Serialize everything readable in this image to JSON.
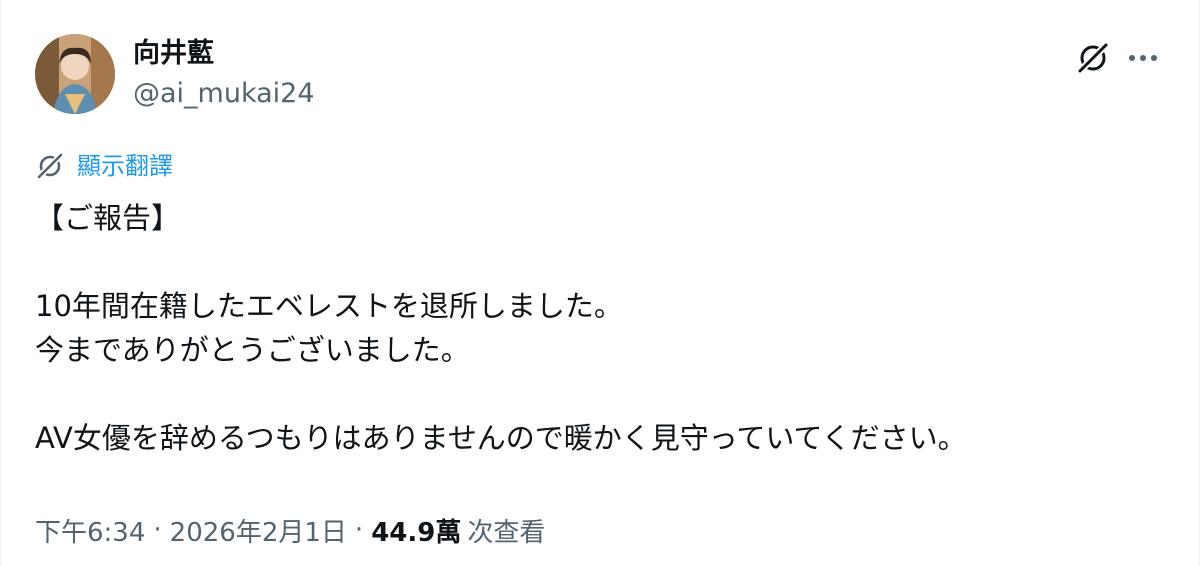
{
  "author": {
    "display_name": "向井藍",
    "handle": "@ai_mukai24"
  },
  "actions": {
    "grok_icon": "grok-icon",
    "more_icon": "more-icon"
  },
  "translate": {
    "label": "顯示翻譯"
  },
  "tweet": {
    "lines": [
      "【ご報告】",
      "",
      "10年間在籍したエベレストを退所しました。",
      "今までありがとうございました。",
      "",
      "AV女優を辞めるつもりはありませんので暖かく見守っていてください。"
    ]
  },
  "meta": {
    "time": "下午6:34",
    "date": "2026年2月1日",
    "views_count": "44.9萬",
    "views_label": "次查看",
    "separator": "·"
  },
  "colors": {
    "text": "#0f1419",
    "secondary": "#536471",
    "link": "#1d9bf0"
  }
}
